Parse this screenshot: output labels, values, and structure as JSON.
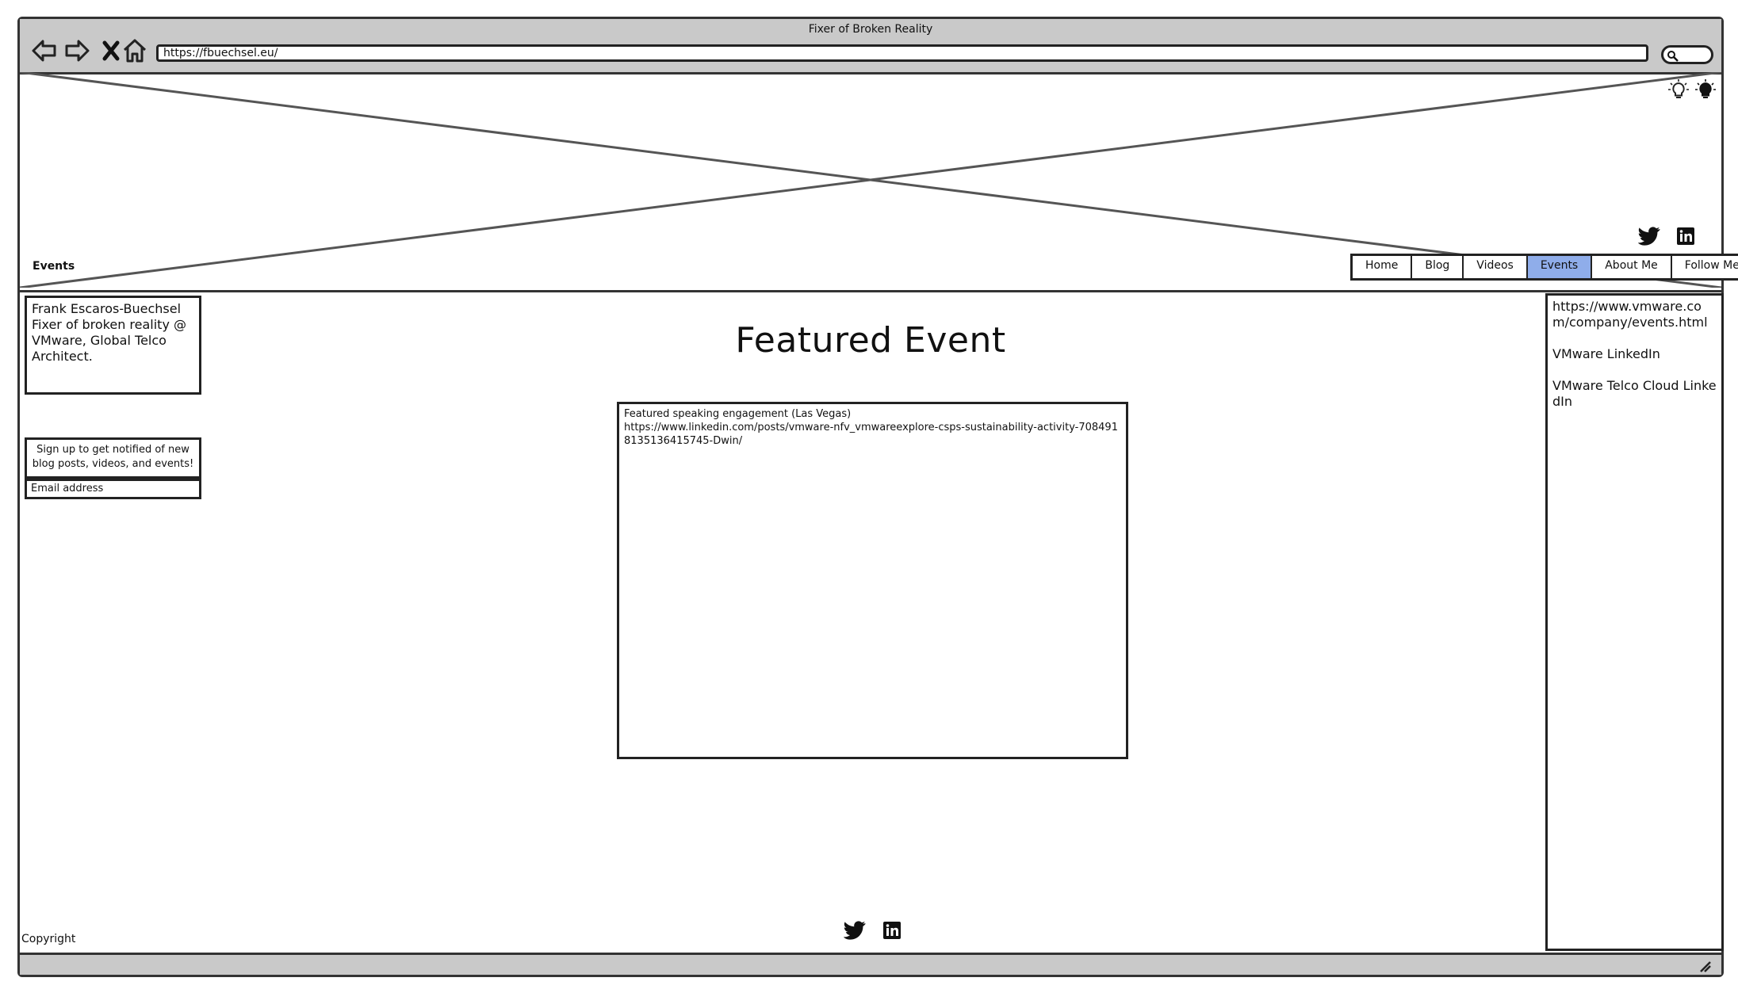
{
  "window": {
    "title": "Fixer of Broken Reality"
  },
  "browser": {
    "url": "https://fbuechsel.eu/",
    "back_icon": "arrow-left-icon",
    "forward_icon": "arrow-right-icon",
    "stop_icon": "close-icon",
    "home_icon": "home-icon",
    "search_icon": "search-icon"
  },
  "header": {
    "page_label": "Events",
    "theme_icons": [
      "lightbulb-outline-icon",
      "lightbulb-filled-icon"
    ],
    "social_icons": [
      "twitter-icon",
      "linkedin-icon"
    ],
    "nav": [
      {
        "label": "Home",
        "active": false
      },
      {
        "label": "Blog",
        "active": false
      },
      {
        "label": "Videos",
        "active": false
      },
      {
        "label": "Events",
        "active": true
      },
      {
        "label": "About Me",
        "active": false
      },
      {
        "label": "Follow Me",
        "active": false
      }
    ],
    "active_color": "#8fadea"
  },
  "sidebar_left": {
    "profile": {
      "name": "Frank Escaros-Buechsel",
      "tagline": "Fixer of broken reality @ VMware, Global Telco Architect."
    },
    "signup_text": "Sign up to get notified of new blog posts, videos, and events!",
    "email_placeholder": "Email address"
  },
  "main": {
    "title": "Featured Event",
    "featured": {
      "line1": "Featured speaking engagement (Las Vegas)",
      "line2": "https://www.linkedin.com/posts/vmware-nfv_vmwareexplore-csps-sustainability-activity-7084918135136415745-Dwin/"
    }
  },
  "sidebar_right": {
    "links": [
      "https://www.vmware.com/company/events.html",
      "VMware LinkedIn",
      "VMware Telco Cloud LinkedIn"
    ]
  },
  "footer": {
    "social_icons": [
      "twitter-icon",
      "linkedin-icon"
    ],
    "copyright": "Copyright"
  }
}
